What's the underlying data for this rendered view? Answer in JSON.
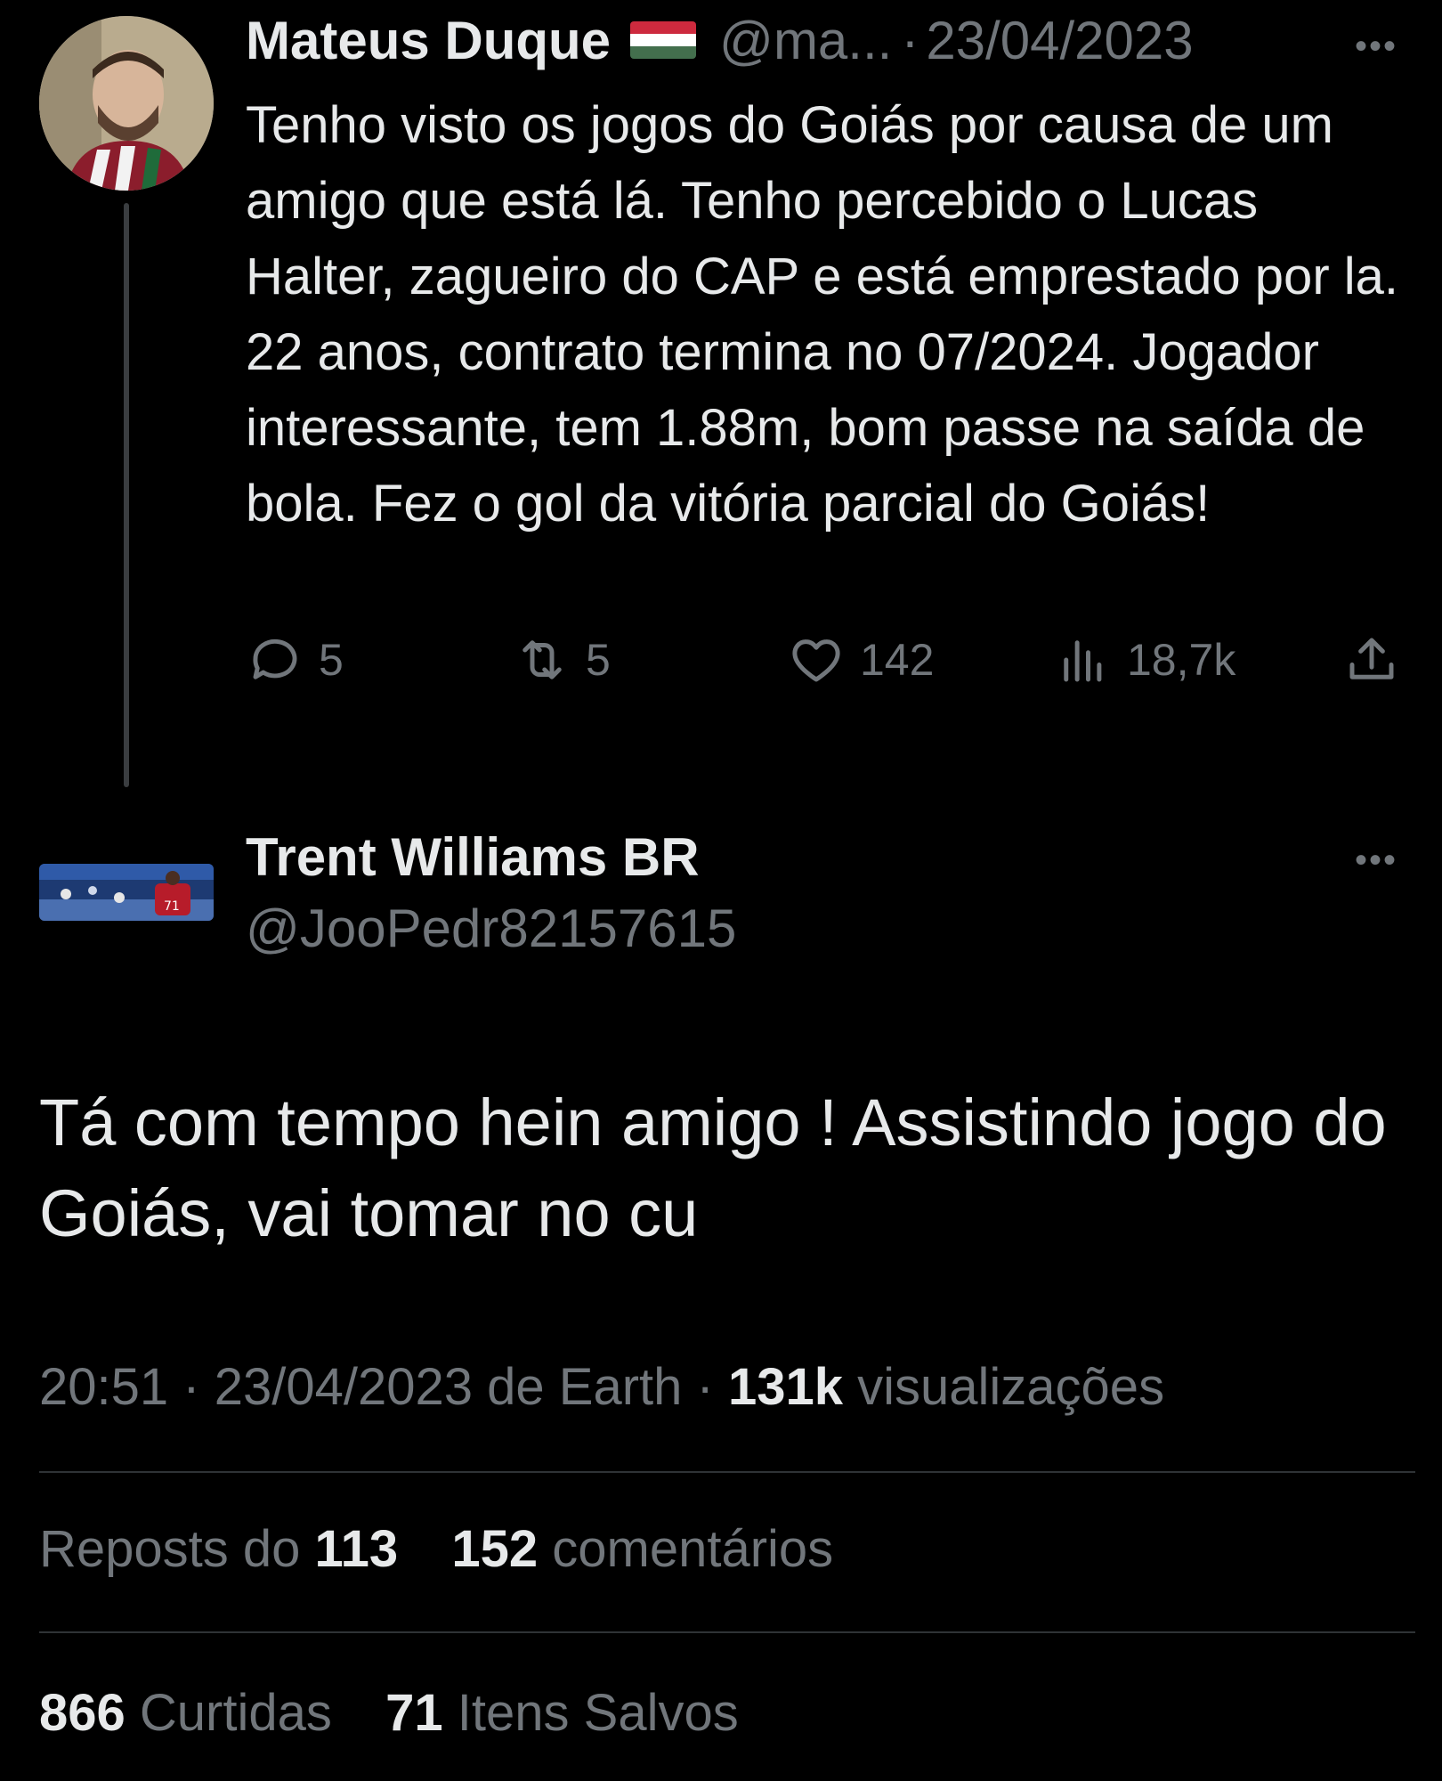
{
  "parent_tweet": {
    "author_name": "Mateus Duque",
    "flag_emoji": "🇭🇺",
    "handle": "@ma...",
    "separator": "·",
    "date": "23/04/2023",
    "more_icon": "ellipsis-icon",
    "text": "Tenho visto os jogos do Goiás por causa de um amigo que está lá. Tenho percebido o Lucas Halter, zagueiro do CAP e está emprestado por la. 22 anos, contrato termina no 07/2024. Jogador interessante, tem 1.88m, bom passe na saída de bola. Fez o gol da vitória parcial do Goiás!",
    "actions": {
      "replies": "5",
      "reposts": "5",
      "likes": "142",
      "views": "18,7k"
    }
  },
  "reply_tweet": {
    "author_name": "Trent Williams BR",
    "handle": "@JooPedr82157615",
    "text": "Tá com tempo hein amigo ! Assistindo jogo do Goiás, vai tomar no cu",
    "time": "20:51",
    "separator": "·",
    "date_source": "23/04/2023 de Earth",
    "views_count": "131k",
    "views_label": "visualizações",
    "reposts_label": "Reposts do",
    "reposts_count": "113",
    "comments_count": "152",
    "comments_label": "comentários",
    "likes_count": "866",
    "likes_label": "Curtidas",
    "saves_count": "71",
    "saves_label": "Itens Salvos"
  },
  "colors": {
    "background": "#000000",
    "text_primary": "#e7e9ea",
    "text_secondary": "#71767b",
    "divider": "#2f3336"
  }
}
